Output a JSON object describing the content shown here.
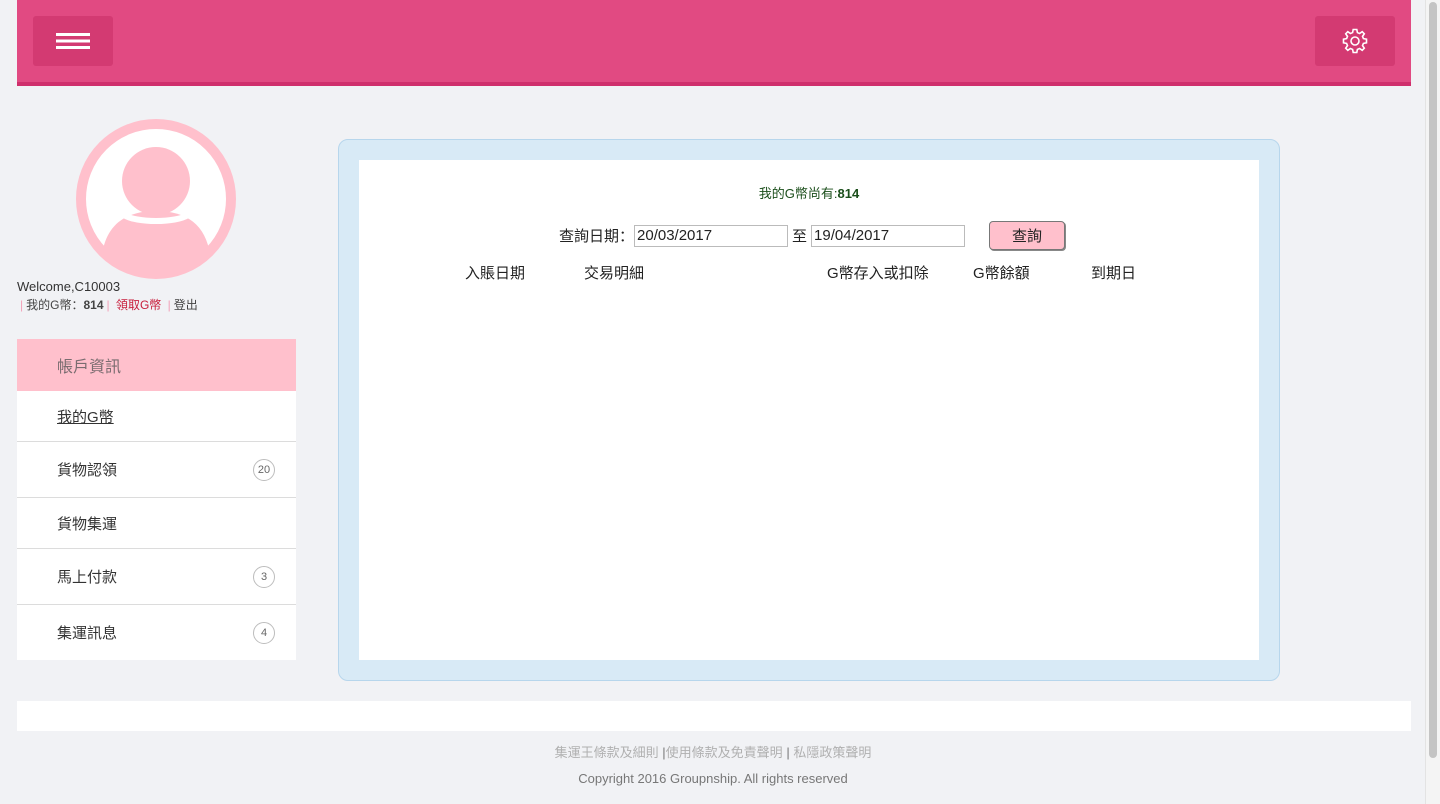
{
  "header": {
    "menu_icon": "hamburger-icon",
    "settings_icon": "gear-icon",
    "bar_color": "#e14a82"
  },
  "user": {
    "welcome": "Welcome,C10003",
    "coins_label": "我的G幣：",
    "coins_value": "814",
    "claim_label": "領取G幣",
    "logout_label": "登出",
    "avatar_icon": "user-avatar-icon"
  },
  "sidebar": {
    "header": "帳戶資訊",
    "items": [
      {
        "label": "我的G幣",
        "badge": ""
      },
      {
        "label": "貨物認領",
        "badge": "20"
      },
      {
        "label": "貨物集運",
        "badge": ""
      },
      {
        "label": "馬上付款",
        "badge": "3"
      },
      {
        "label": "集運訊息",
        "badge": "4"
      }
    ]
  },
  "main": {
    "balance_label": "我的G幣尚有:",
    "balance_value": "814",
    "query": {
      "label": "查詢日期：",
      "from": "20/03/2017",
      "to_label": "至",
      "to": "19/04/2017",
      "button": "查詢"
    },
    "columns": [
      "入賬日期",
      "交易明細",
      "G幣存入或扣除",
      "G幣餘額",
      "到期日"
    ]
  },
  "footer": {
    "link1": "集運王條款及細則",
    "link2": "使用條款及免責聲明",
    "link3": "私隱政策聲明",
    "pipe": "|",
    "copyright": "Copyright 2016 Groupnship. All rights reserved"
  }
}
